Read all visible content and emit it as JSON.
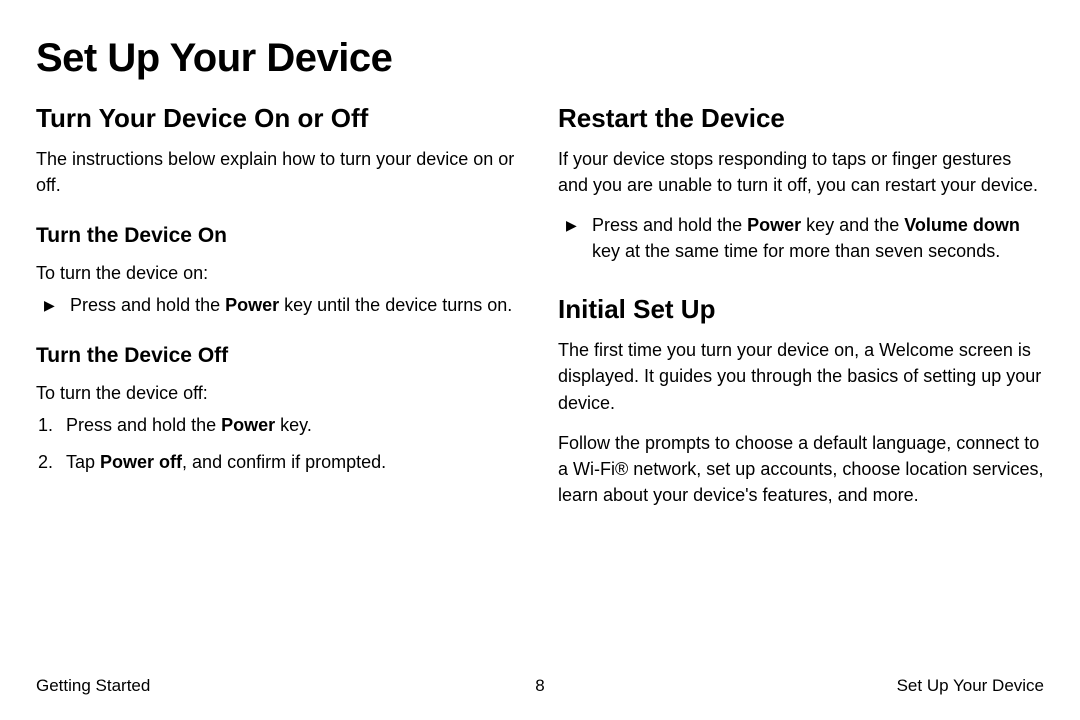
{
  "title": "Set Up Your Device",
  "left": {
    "h2": "Turn Your Device On or Off",
    "intro": "The instructions below explain how to turn your device on or off.",
    "turnOn": {
      "h3": "Turn the Device On",
      "lead": "To turn the device on:",
      "bullet_pre": "Press and hold the ",
      "bullet_bold": "Power",
      "bullet_post": " key until the device turns on."
    },
    "turnOff": {
      "h3": "Turn the Device Off",
      "lead": "To turn the device off:",
      "step1_pre": "Press and hold the ",
      "step1_bold": "Power",
      "step1_post": " key.",
      "step1_num": "1.",
      "step2_pre": "Tap ",
      "step2_bold": "Power off",
      "step2_post": ", and confirm if prompted.",
      "step2_num": "2."
    }
  },
  "right": {
    "restart": {
      "h2": "Restart the Device",
      "intro": "If your device stops responding to taps or finger gestures and you are unable to turn it off, you can restart your device.",
      "bullet_pre": "Press and hold the ",
      "bullet_bold1": "Power",
      "bullet_mid": " key and the ",
      "bullet_bold2": "Volume down",
      "bullet_post": " key at the same time for more than seven seconds."
    },
    "initial": {
      "h2": "Initial Set Up",
      "p1": "The first time you turn your device on, a Welcome screen is displayed. It guides you through the basics of setting up your device.",
      "p2": "Follow the prompts to choose a default language, connect to a Wi-Fi® network, set up accounts, choose location services, learn about your device's features, and more."
    }
  },
  "footer": {
    "left": "Getting Started",
    "center": "8",
    "right": "Set Up Your Device"
  },
  "markers": {
    "triangle": "▶"
  }
}
